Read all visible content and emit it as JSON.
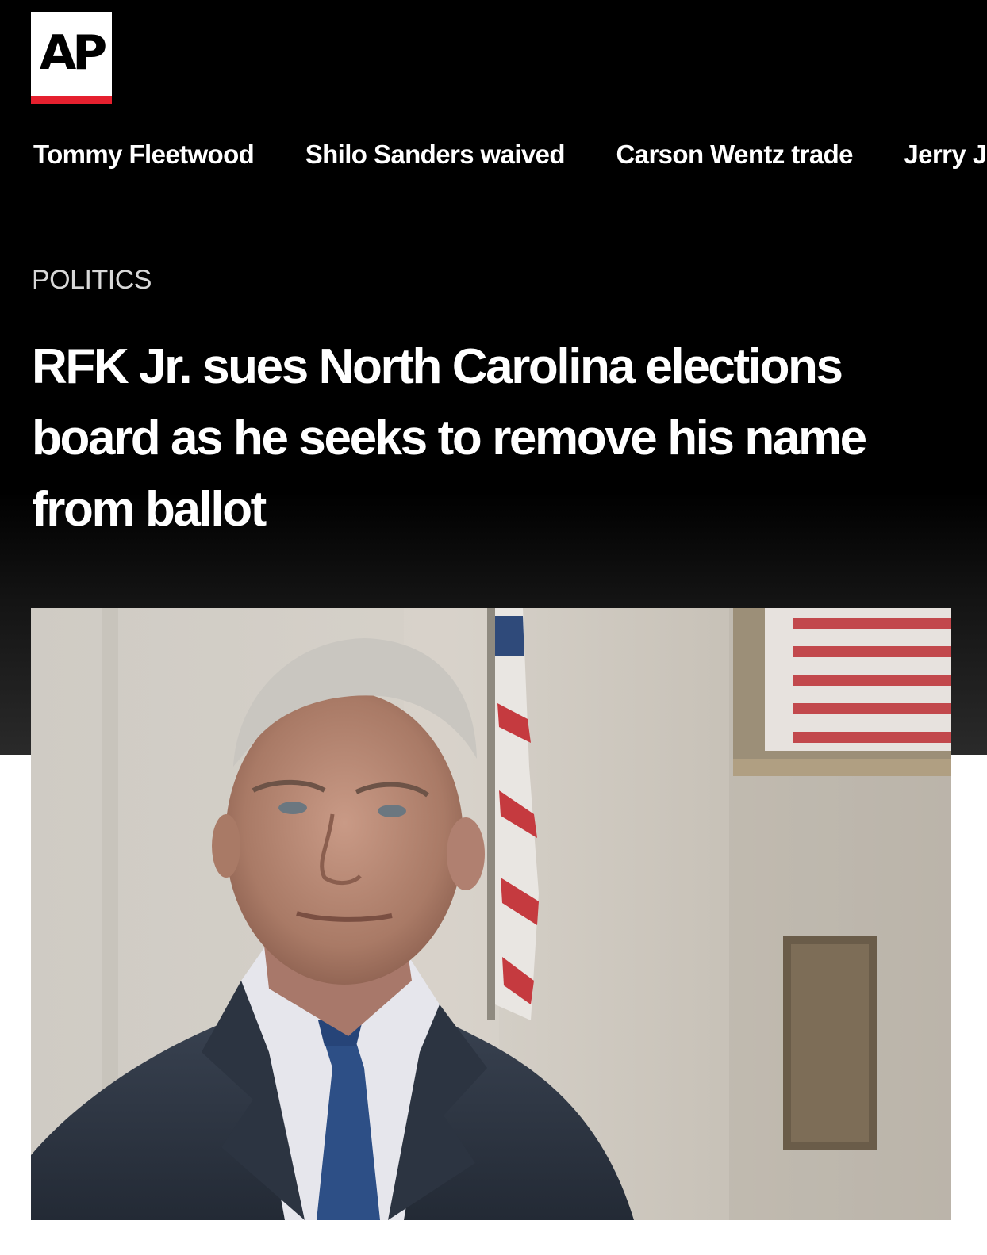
{
  "brand": {
    "logo_text": "AP",
    "accent_color": "#e5202e"
  },
  "trending": [
    {
      "label": "Tommy Fleetwood"
    },
    {
      "label": "Shilo Sanders waived"
    },
    {
      "label": "Carson Wentz trade"
    },
    {
      "label": "Jerry Jones"
    }
  ],
  "article": {
    "section": "POLITICS",
    "headline": "RFK Jr. sues North Carolina elections board as he seeks to remove his name from ballot"
  },
  "colors": {
    "masthead_bg": "#000000",
    "page_bg": "#ffffff",
    "headline_text": "#ffffff"
  }
}
